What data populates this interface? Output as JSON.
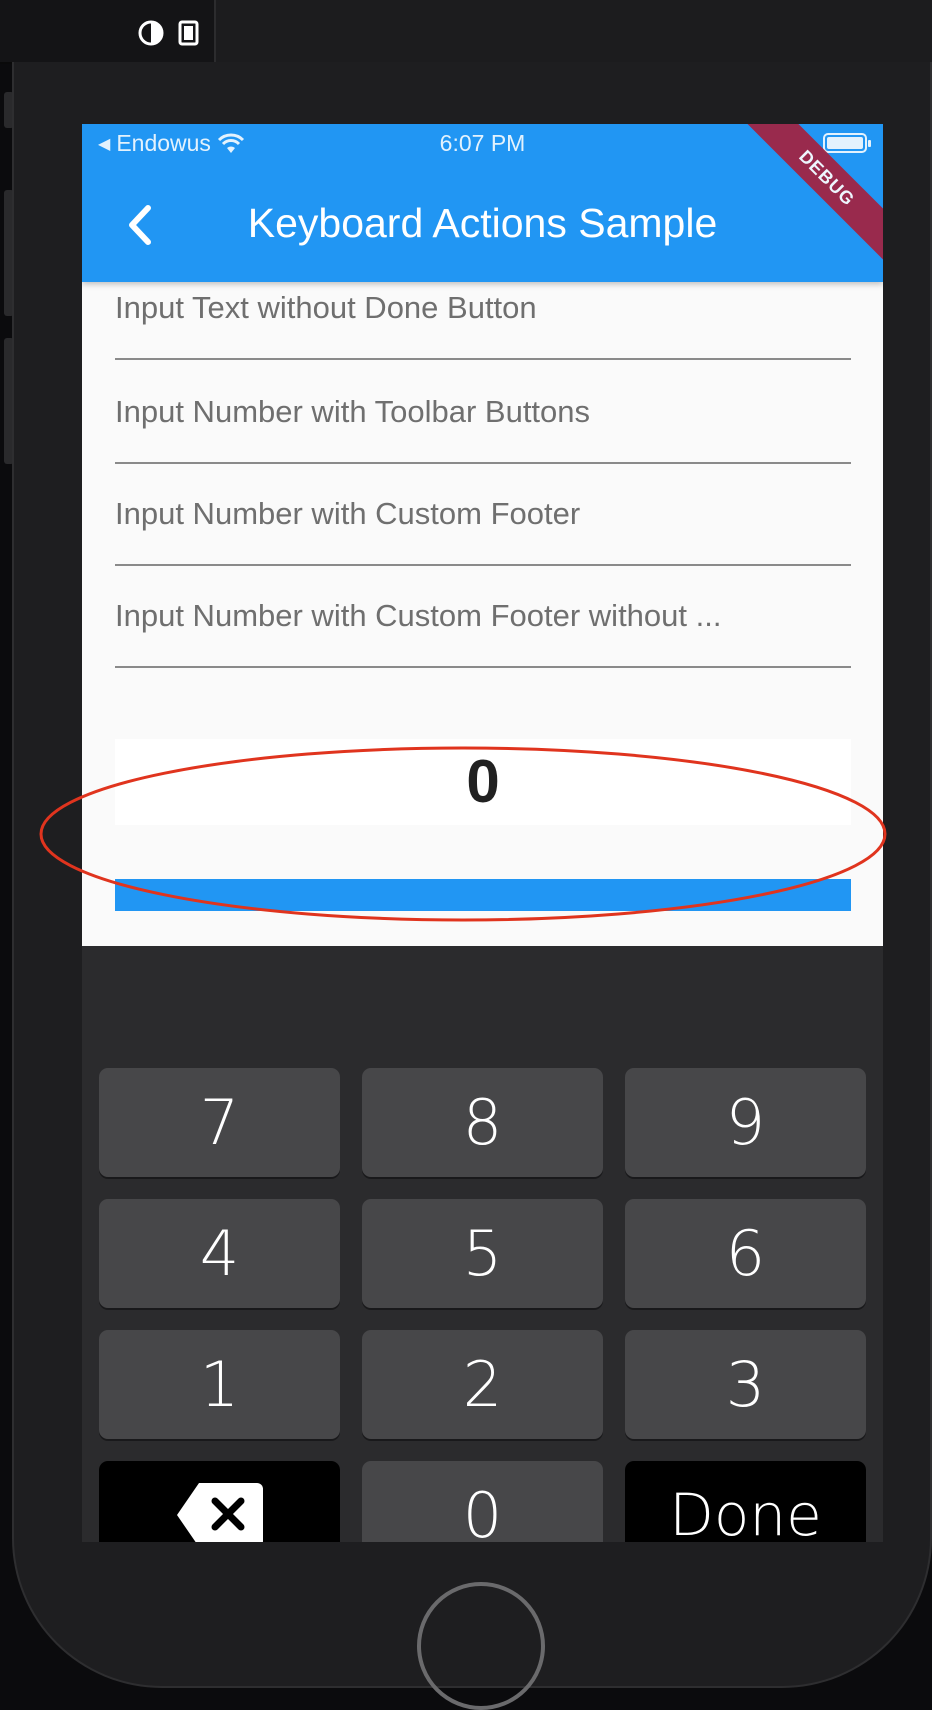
{
  "status_bar": {
    "carrier": "Endowus",
    "time": "6:07 PM"
  },
  "app_bar": {
    "title": "Keyboard Actions Sample",
    "debug_label": "DEBUG"
  },
  "fields": [
    {
      "text": "Input Text without Done Button"
    },
    {
      "text": "Input Number with Toolbar Buttons"
    },
    {
      "text": "Input Number with Custom Footer"
    },
    {
      "text": "Input Number with Custom Footer without ..."
    }
  ],
  "counter": {
    "value": "0"
  },
  "keyboard": {
    "keys": [
      "7",
      "8",
      "9",
      "4",
      "5",
      "6",
      "1",
      "2",
      "3"
    ],
    "zero": "0",
    "done": "Done"
  },
  "colors": {
    "app_bar": "#2196f3",
    "debug_ribbon": "#a4213f",
    "keyboard_bg": "#2b2b2d",
    "key_bg": "#474749",
    "annotation": "#e0341e"
  },
  "icons": [
    "back-arrow-icon",
    "wifi-icon",
    "battery-icon",
    "backspace-icon",
    "contrast-icon",
    "device-rotate-icon"
  ]
}
